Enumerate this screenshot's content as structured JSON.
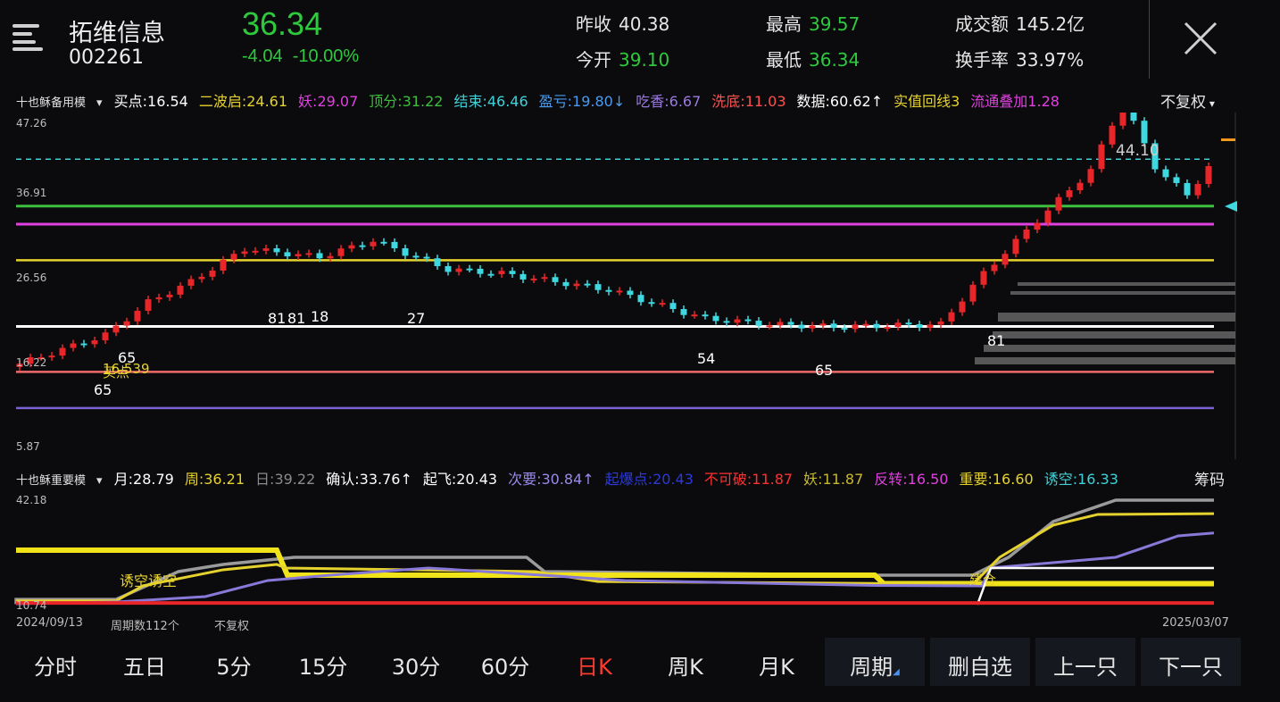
{
  "stock": {
    "name": "拓维信息",
    "code": "002261",
    "price": "36.34",
    "change": "-4.04",
    "change_pct": "-10.00%"
  },
  "stats": [
    {
      "label": "昨收",
      "value": "40.38",
      "color": "#e6e6e6"
    },
    {
      "label": "今开",
      "value": "39.10",
      "color": "#2fc93e"
    },
    {
      "label": "最高",
      "value": "39.57",
      "color": "#2fc93e"
    },
    {
      "label": "最低",
      "value": "36.34",
      "color": "#2fc93e"
    },
    {
      "label": "成交额",
      "value": "145.2亿",
      "color": "#e6e6e6"
    },
    {
      "label": "换手率",
      "value": "33.97%",
      "color": "#e6e6e6"
    }
  ],
  "indicator1": {
    "name": "十也稣备用模",
    "items": [
      {
        "text": "买点:16.54",
        "color": "#ffffff"
      },
      {
        "text": "二波启:24.61",
        "color": "#e6d22e"
      },
      {
        "text": "妖:29.07",
        "color": "#e040e0"
      },
      {
        "text": "顶分:31.22",
        "color": "#3cbf3c"
      },
      {
        "text": "结束:46.46",
        "color": "#3fd1d8"
      },
      {
        "text": "盈亏:19.80↓",
        "color": "#4a9af0"
      },
      {
        "text": "吃香:6.67",
        "color": "#9a7ae0"
      },
      {
        "text": "洗底:11.03",
        "color": "#ff5050"
      },
      {
        "text": "数据:60.62↑",
        "color": "#ffffff"
      },
      {
        "text": "实值回线3",
        "color": "#e6d22e"
      },
      {
        "text": "流通叠加1.28",
        "color": "#e040e0"
      }
    ],
    "right": "不复权"
  },
  "indicator2": {
    "name": "十也稣重要模",
    "items": [
      {
        "text": "月:28.79",
        "color": "#ffffff"
      },
      {
        "text": "周:36.21",
        "color": "#e6d22e"
      },
      {
        "text": "日:39.22",
        "color": "#8a8a8a"
      },
      {
        "text": "确认:33.76↑",
        "color": "#ffffff"
      },
      {
        "text": "起飞:20.43",
        "color": "#ffffff"
      },
      {
        "text": "次要:30.84↑",
        "color": "#9a8ae8"
      },
      {
        "text": "起爆点:20.43",
        "color": "#2b3ad6"
      },
      {
        "text": "不可破:11.87",
        "color": "#ff3030"
      },
      {
        "text": "妖:11.87",
        "color": "#c8b830"
      },
      {
        "text": "反转:16.50",
        "color": "#e040e0"
      },
      {
        "text": "重要:16.60",
        "color": "#e6d22e"
      },
      {
        "text": "诱空:16.33",
        "color": "#3fd1d8"
      }
    ],
    "right": "筹码"
  },
  "main_axis": [
    "47.26",
    "36.91",
    "26.56",
    "16.22",
    "5.87"
  ],
  "sub_axis": [
    "42.18",
    "10.74"
  ],
  "chart_labels": {
    "high": "44.10",
    "buy": "买点",
    "buy_price": "16.539",
    "trap": "诱空诱空",
    "build": "建仓"
  },
  "candle_labels": [
    "65",
    "65",
    "81",
    "81",
    "18",
    "27",
    "54",
    "65",
    "81"
  ],
  "date_start": "2024/09/13",
  "period_count": "周期数112个",
  "no_adjust": "不复权",
  "date_end": "2025/03/07",
  "tabs": [
    "分时",
    "五日",
    "5分",
    "15分",
    "30分",
    "60分",
    "日K",
    "周K",
    "月K",
    "周期"
  ],
  "buttons": [
    "删自选",
    "上一只",
    "下一只"
  ],
  "colors": {
    "up": "#e8262a",
    "down": "#3fd8e0",
    "green": "#2fc93e",
    "active_tab": "#ff3b30"
  }
}
